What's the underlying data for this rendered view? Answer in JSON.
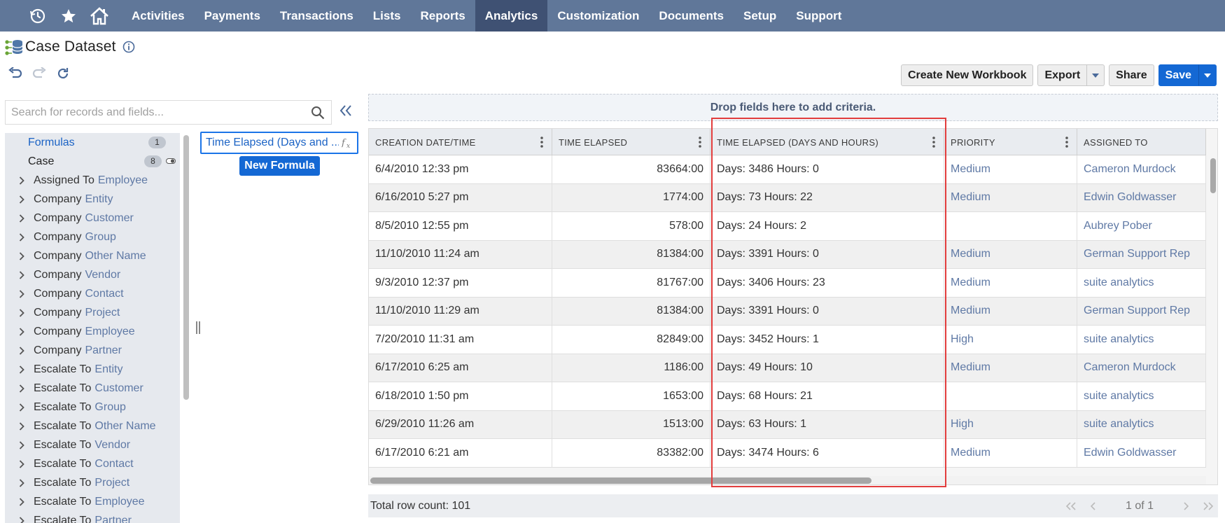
{
  "nav": {
    "items": [
      "Activities",
      "Payments",
      "Transactions",
      "Lists",
      "Reports",
      "Analytics",
      "Customization",
      "Documents",
      "Setup",
      "Support"
    ],
    "active": "Analytics"
  },
  "page": {
    "title": "Case Dataset"
  },
  "actions": {
    "create_workbook": "Create New Workbook",
    "export": "Export",
    "share": "Share",
    "save": "Save"
  },
  "search": {
    "placeholder": "Search for records and fields..."
  },
  "tree": {
    "formulas_label": "Formulas",
    "formulas_count": "1",
    "case_label": "Case",
    "case_count": "8",
    "items": [
      {
        "prefix": "Assigned To",
        "suffix": "Employee"
      },
      {
        "prefix": "Company",
        "suffix": "Entity"
      },
      {
        "prefix": "Company",
        "suffix": "Customer"
      },
      {
        "prefix": "Company",
        "suffix": "Group"
      },
      {
        "prefix": "Company",
        "suffix": "Other Name"
      },
      {
        "prefix": "Company",
        "suffix": "Vendor"
      },
      {
        "prefix": "Company",
        "suffix": "Contact"
      },
      {
        "prefix": "Company",
        "suffix": "Project"
      },
      {
        "prefix": "Company",
        "suffix": "Employee"
      },
      {
        "prefix": "Company",
        "suffix": "Partner"
      },
      {
        "prefix": "Escalate To",
        "suffix": "Entity"
      },
      {
        "prefix": "Escalate To",
        "suffix": "Customer"
      },
      {
        "prefix": "Escalate To",
        "suffix": "Group"
      },
      {
        "prefix": "Escalate To",
        "suffix": "Other Name"
      },
      {
        "prefix": "Escalate To",
        "suffix": "Vendor"
      },
      {
        "prefix": "Escalate To",
        "suffix": "Contact"
      },
      {
        "prefix": "Escalate To",
        "suffix": "Project"
      },
      {
        "prefix": "Escalate To",
        "suffix": "Employee"
      },
      {
        "prefix": "Escalate To",
        "suffix": "Partner"
      }
    ]
  },
  "formula": {
    "field_text": "Time Elapsed (Days and ...",
    "new_button": "New Formula"
  },
  "criteria": {
    "drop_text": "Drop fields here to add criteria."
  },
  "grid": {
    "columns": [
      "CREATION DATE/TIME",
      "TIME ELAPSED",
      "TIME ELAPSED (DAYS AND HOURS)",
      "PRIORITY",
      "ASSIGNED TO"
    ],
    "rows": [
      [
        "6/4/2010 12:33 pm",
        "83664:00",
        "Days: 3486 Hours: 0",
        "Medium",
        "Cameron Murdock"
      ],
      [
        "6/16/2010 5:27 pm",
        "1774:00",
        "Days: 73 Hours: 22",
        "Medium",
        "Edwin Goldwasser"
      ],
      [
        "8/5/2010 12:55 pm",
        "578:00",
        "Days: 24 Hours: 2",
        "",
        "Aubrey Pober"
      ],
      [
        "11/10/2010 11:24 am",
        "81384:00",
        "Days: 3391 Hours: 0",
        "Medium",
        "German Support Rep"
      ],
      [
        "9/3/2010 12:37 pm",
        "81767:00",
        "Days: 3406 Hours: 23",
        "Medium",
        "suite analytics"
      ],
      [
        "11/10/2010 11:29 am",
        "81384:00",
        "Days: 3391 Hours: 0",
        "Medium",
        "German Support Rep"
      ],
      [
        "7/20/2010 11:31 am",
        "82849:00",
        "Days: 3452 Hours: 1",
        "High",
        "suite analytics"
      ],
      [
        "6/17/2010 6:25 am",
        "1186:00",
        "Days: 49 Hours: 10",
        "Medium",
        "Cameron Murdock"
      ],
      [
        "6/18/2010 1:50 pm",
        "1653:00",
        "Days: 68 Hours: 21",
        "",
        "suite analytics"
      ],
      [
        "6/29/2010 11:26 am",
        "1513:00",
        "Days: 63 Hours: 1",
        "High",
        "suite analytics"
      ],
      [
        "6/17/2010 6:21 am",
        "83382:00",
        "Days: 3474 Hours: 6",
        "Medium",
        "Edwin Goldwasser"
      ]
    ]
  },
  "footer": {
    "row_count": "Total row count: 101",
    "page_indicator": "1 of 1"
  },
  "colors": {
    "nav_bg": "#607799",
    "nav_active": "#3f5173",
    "primary": "#1468d4",
    "link": "#5f79a5",
    "highlight": "#e23d3d"
  }
}
